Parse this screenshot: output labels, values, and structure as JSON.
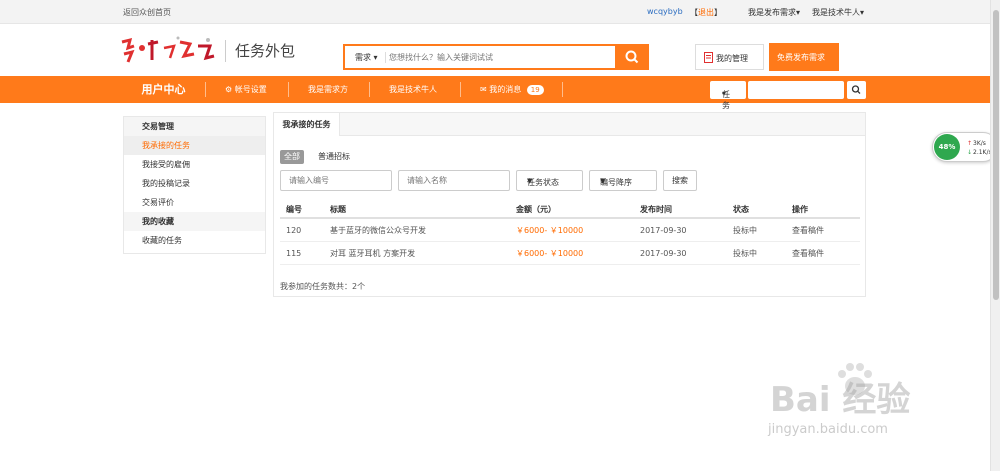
{
  "topbar": {
    "home_link": "返回众创首页",
    "username": "wcqybyb",
    "logout_open": "【",
    "logout_label": "退出",
    "logout_close": "】",
    "publisher_dropdown": "我是发布需求",
    "tech_dropdown": "我是技术牛人"
  },
  "header": {
    "logo_title": "任务外包",
    "search": {
      "category": "需求",
      "placeholder": "您想找什么？输入关键词试试"
    },
    "manage_button": "我的管理",
    "publish_button": "免费发布需求"
  },
  "nav": {
    "user_center": "用户中心",
    "items": [
      {
        "label": "帐号设置",
        "icon": "gears-icon"
      },
      {
        "label": "我是需求方"
      },
      {
        "label": "我是技术牛人"
      },
      {
        "label": "我的消息",
        "icon": "envelope-icon",
        "badge": "19"
      }
    ],
    "search_select": "任务",
    "search_input": ""
  },
  "sidebar": {
    "group1": "交易管理",
    "links1": [
      "我承接的任务",
      "我接受的雇佣",
      "我的投稿记录",
      "交易评价"
    ],
    "group2": "我的收藏",
    "links2": [
      "收藏的任务"
    ]
  },
  "panel": {
    "tab": "我承接的任务",
    "filter_all": "全部",
    "filter_normal": "普通招标",
    "number_placeholder": "请输入编号",
    "name_placeholder": "请输入名称",
    "status_select": "任务状态",
    "order_select": "编号降序",
    "search_button": "搜索",
    "headers": [
      "编号",
      "标题",
      "金额（元）",
      "发布时间",
      "状态",
      "操作"
    ],
    "rows": [
      {
        "id": "120",
        "title": "基于蓝牙的微信公众号开发",
        "amount": "￥6000- ￥10000",
        "date": "2017-09-30",
        "status": "投标中",
        "action": "查看稿件"
      },
      {
        "id": "115",
        "title": "对耳 蓝牙耳机 方案开发",
        "amount": "￥6000- ￥10000",
        "date": "2017-09-30",
        "status": "投标中",
        "action": "查看稿件"
      }
    ],
    "count_text": "我参加的任务数共：2个"
  },
  "net_widget": {
    "percent": "48%",
    "up": "3K/s",
    "down": "2.1K/s"
  },
  "watermark": {
    "brand": "Bai 经验",
    "url": "jingyan.baidu.com"
  },
  "colors": {
    "accent": "#ff7a1a",
    "link_blue": "#2a6cc0",
    "amount": "#ff6a00"
  }
}
